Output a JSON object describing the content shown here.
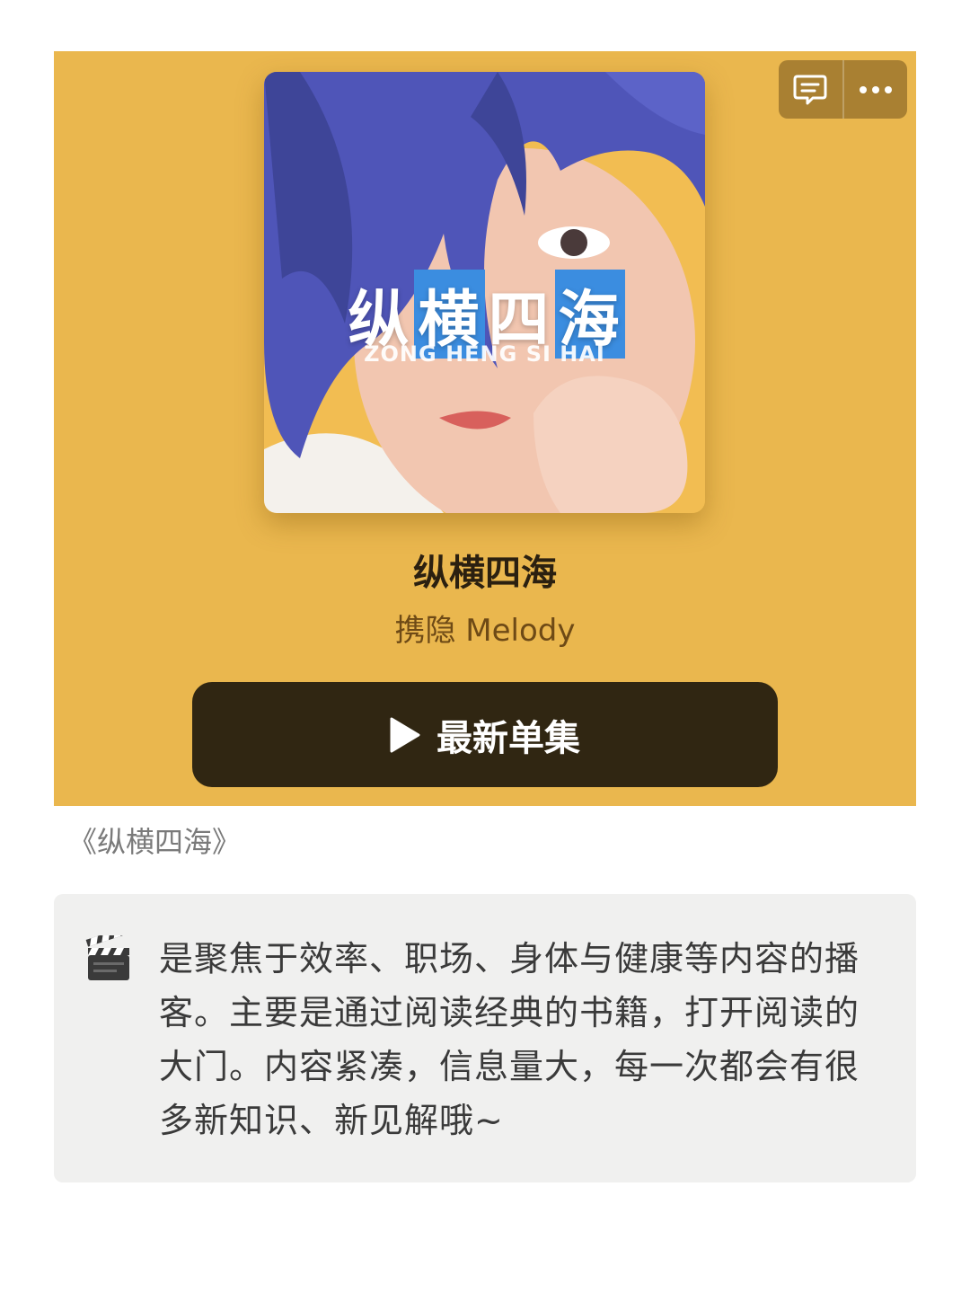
{
  "card": {
    "background_color": "#EAB74E",
    "comment_icon": "comment-icon",
    "more_icon": "more-icon",
    "cover": {
      "title_chars": [
        "纵",
        "横",
        "四",
        "海"
      ],
      "subtitle": "ZONG HENG SI HAI"
    },
    "title": "纵横四海",
    "author": "携隐 Melody",
    "play_button": {
      "icon": "play-icon",
      "label": "最新单集"
    }
  },
  "caption": "《纵横四海》",
  "description": {
    "icon": "clapperboard-icon",
    "text": "是聚焦于效率、职场、身体与健康等内容的播客。主要是通过阅读经典的书籍，打开阅读的大门。内容紧凑，信息量大，每一次都会有很多新知识、新见解哦~"
  }
}
